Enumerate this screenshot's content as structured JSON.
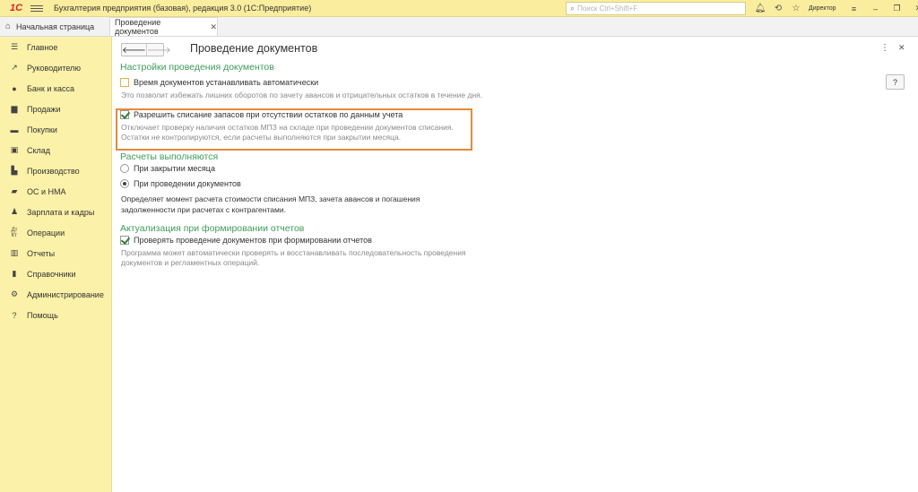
{
  "titlebar": {
    "logo": "1С",
    "title": "Бухгалтерия предприятия (базовая), редакция 3.0  (1С:Предприятие)",
    "search_placeholder": "Поиск Ctrl+Shift+F",
    "user": "Директор"
  },
  "tabs": {
    "home": "Начальная страница",
    "active": "Проведение документов"
  },
  "sidebar": {
    "items": [
      {
        "label": "Главное",
        "icon": "menu-icon"
      },
      {
        "label": "Руководителю",
        "icon": "trend-icon"
      },
      {
        "label": "Банк и касса",
        "icon": "coin-icon"
      },
      {
        "label": "Продажи",
        "icon": "bag-icon"
      },
      {
        "label": "Покупки",
        "icon": "cart-icon"
      },
      {
        "label": "Склад",
        "icon": "warehouse-icon"
      },
      {
        "label": "Производство",
        "icon": "factory-icon"
      },
      {
        "label": "ОС и НМА",
        "icon": "truck-icon"
      },
      {
        "label": "Зарплата и кадры",
        "icon": "person-icon"
      },
      {
        "label": "Операции",
        "icon": "operations-icon"
      },
      {
        "label": "Отчеты",
        "icon": "chart-icon"
      },
      {
        "label": "Справочники",
        "icon": "book-icon"
      },
      {
        "label": "Администрирование",
        "icon": "gear-icon"
      },
      {
        "label": "Помощь",
        "icon": "question-icon"
      }
    ]
  },
  "main": {
    "title": "Проведение документов",
    "help": "?",
    "section1": {
      "heading": "Настройки проведения документов",
      "time_auto_label": "Время документов устанавливать автоматически",
      "time_auto_hint": "Это позволит избежать лишних оборотов по зачету авансов и отрицательных остатков в течение дня.",
      "allow_writeoff_label": "Разрешить списание запасов при отсутствии остатков по данным учета",
      "allow_writeoff_hint1": "Отключает проверку наличия остатков МПЗ на складе при проведении документов списания.",
      "allow_writeoff_hint2": "Остатки не контролируются, если расчеты выполняются при закрытии месяца."
    },
    "section2": {
      "heading": "Расчеты выполняются",
      "radio_month": "При закрытии месяца",
      "radio_posting": "При проведении документов",
      "desc1": "Определяет момент расчета стоимости списания МПЗ, зачета авансов и погашения",
      "desc2": "задолженности при расчетах с контрагентами."
    },
    "section3": {
      "heading": "Актуализация при формировании отчетов",
      "check_label": "Проверять проведение документов при формировании отчетов",
      "hint1": "Программа может автоматически проверять и восстанавливать последовательность проведения",
      "hint2": "документов и регламентных операций."
    }
  }
}
